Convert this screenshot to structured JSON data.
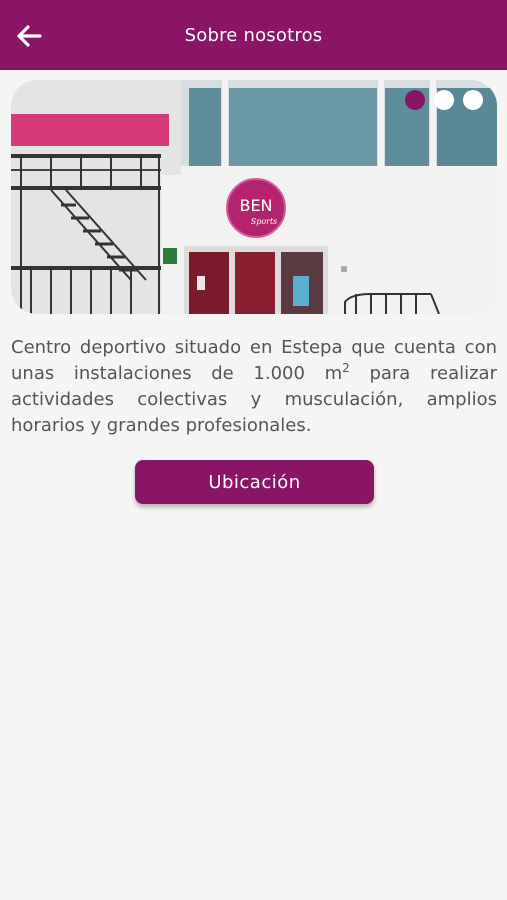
{
  "header": {
    "title": "Sobre nosotros",
    "back_icon": "arrow-left-icon"
  },
  "carousel": {
    "slide_count": 3,
    "active_index": 0,
    "logo_main": "BEN",
    "logo_script": "Sports"
  },
  "about": {
    "text_before": "Centro deportivo situado en Estepa que cuenta con unas instalaciones de 1.000 m",
    "superscript": "2",
    "text_after": " para realizar actividades colectivas y musculación, amplios horarios y grandes profesionales."
  },
  "location_button": {
    "label": "Ubicación"
  },
  "colors": {
    "primary": "#8a1567",
    "background": "#f5f5f5",
    "text": "#555555"
  }
}
